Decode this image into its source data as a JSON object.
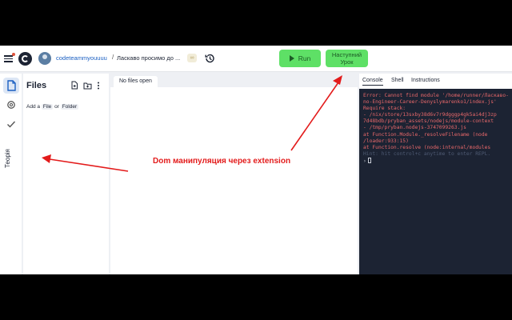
{
  "header": {
    "owner": "codeteammyouuuu",
    "separator": "/",
    "project": "Ласкаво просимо до ...",
    "badge": "∞",
    "run_label": "Run",
    "next_lesson_label": "Наступний Урок"
  },
  "sidebar": {
    "vertical_label": "Теорія"
  },
  "files": {
    "title": "Files",
    "hint_prefix": "Add a",
    "hint_file": "File",
    "hint_or": "or",
    "hint_folder": "Folder"
  },
  "editor": {
    "empty_tab": "No files open"
  },
  "console": {
    "tabs": [
      "Console",
      "Shell",
      "Instructions"
    ],
    "lines": [
      "Error: Cannot find module '/home/runner/Ласкаво-",
      "no-Engineer-Career-Denyslymarenko1/index.js'",
      "Require stack:",
      "- /nix/store/13sxby38d6v7r9dgggp4gk5ai4dj3zp",
      "7d48bdb/pryban_assets/nodejs/module-context",
      "- /tmp/pryban.nodejs-3747099263.js",
      "    at Function.Module._resolveFilename (node",
      "/loader:933:15)",
      "    at Function.resolve (node:internal/modules"
    ],
    "faded_line": "Hint: hit control+c anytime to enter REPL.",
    "prompt": "›"
  },
  "annotation": {
    "text": "Dom манипуляция через extension"
  },
  "colors": {
    "accent_green": "#5ee066",
    "annotation_red": "#e31b1b",
    "console_bg": "#1c2333",
    "error_text": "#e8686a"
  }
}
